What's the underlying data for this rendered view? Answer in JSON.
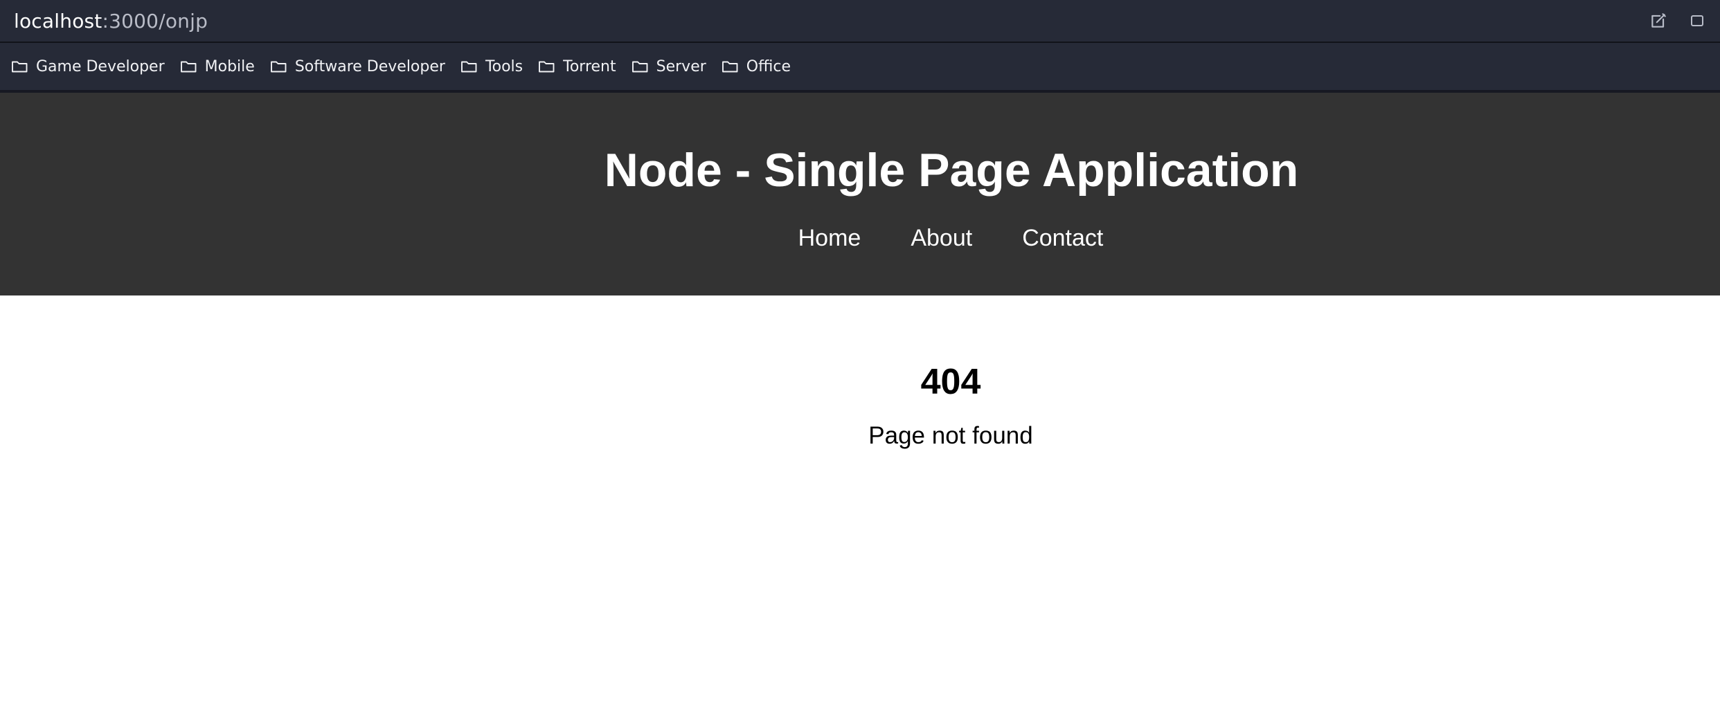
{
  "browser": {
    "url_host": "localhost",
    "url_path": ":3000/onjp",
    "actions": [
      {
        "icon": "edit-icon"
      },
      {
        "icon": "overflow-icon"
      }
    ]
  },
  "bookmarks": [
    {
      "label": "Game Developer",
      "icon": "folder-icon"
    },
    {
      "label": "Mobile",
      "icon": "folder-icon"
    },
    {
      "label": "Software Developer",
      "icon": "folder-icon"
    },
    {
      "label": "Tools",
      "icon": "folder-icon"
    },
    {
      "label": "Torrent",
      "icon": "folder-icon"
    },
    {
      "label": "Server",
      "icon": "folder-icon"
    },
    {
      "label": "Office",
      "icon": "folder-icon"
    }
  ],
  "site": {
    "title": "Node - Single Page Application",
    "nav": [
      {
        "label": "Home"
      },
      {
        "label": "About"
      },
      {
        "label": "Contact"
      }
    ]
  },
  "page": {
    "code": "404",
    "message": "Page not found"
  },
  "colors": {
    "browser_chrome": "#262a37",
    "site_header": "#333333",
    "content_bg": "#ffffff",
    "text_light": "#ffffff",
    "text_dark": "#000000"
  }
}
